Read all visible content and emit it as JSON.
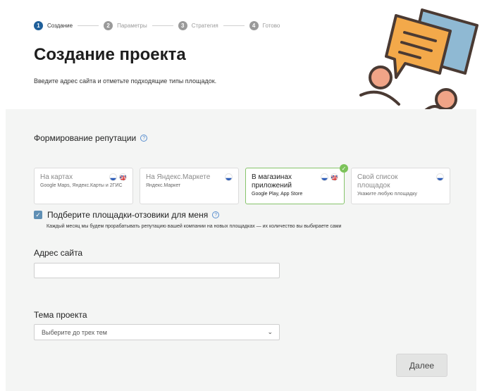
{
  "stepper": {
    "steps": [
      {
        "num": "1",
        "label": "Создание"
      },
      {
        "num": "2",
        "label": "Параметры"
      },
      {
        "num": "3",
        "label": "Стратегия"
      },
      {
        "num": "4",
        "label": "Готово"
      }
    ]
  },
  "header": {
    "title": "Создание проекта",
    "subtitle": "Введите адрес сайта и отметьте подходящие типы площадок."
  },
  "reputation": {
    "title": "Формирование репутации",
    "platforms": [
      {
        "title": "На картах",
        "subtitle": "Google Maps, Яндекс.Карты и 2ГИС",
        "flags": [
          "ru",
          "uk"
        ],
        "selected": false
      },
      {
        "title": "На Яндекс.Маркете",
        "subtitle": "Яндекс.Маркет",
        "flags": [
          "ru"
        ],
        "selected": false
      },
      {
        "title": "В магазинах приложений",
        "subtitle": "Google Play, App Store",
        "flags": [
          "ru",
          "uk"
        ],
        "selected": true
      },
      {
        "title": "Свой список площадок",
        "subtitle": "Укажите любую площадку",
        "flags": [
          "ru"
        ],
        "selected": false
      }
    ],
    "auto_pick_label": "Подберите площадки-отзовики для меня",
    "auto_pick_checked": true,
    "auto_pick_note": "Каждый месяц мы будем прорабатывать репутацию вашей компании на новых площадках — их количество вы выбираете сами"
  },
  "form": {
    "site_label": "Адрес сайта",
    "site_value": "",
    "topic_label": "Тема проекта",
    "topic_placeholder": "Выберите до трех тем"
  },
  "actions": {
    "next_label": "Далее"
  },
  "colors": {
    "accent": "#1f5f9a",
    "selected_border": "#86c46b",
    "check_green": "#7cc35a",
    "checkbox": "#5f8fb4"
  },
  "icons": {
    "help": "help-circle-icon",
    "check": "check-icon",
    "chevron": "chevron-down-icon"
  }
}
